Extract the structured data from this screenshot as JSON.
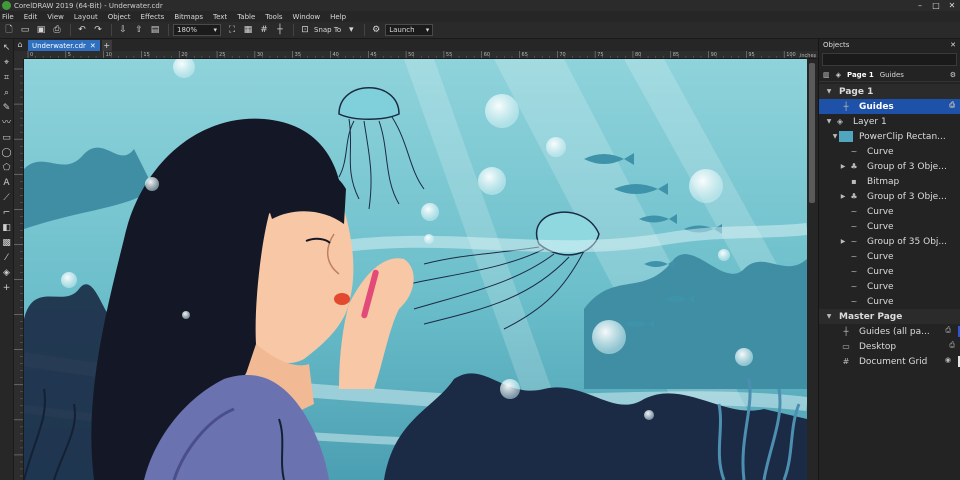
{
  "window": {
    "title": "CorelDRAW 2019 (64-Bit) - Underwater.cdr"
  },
  "menu": [
    "File",
    "Edit",
    "View",
    "Layout",
    "Object",
    "Effects",
    "Bitmaps",
    "Text",
    "Table",
    "Tools",
    "Window",
    "Help"
  ],
  "toolbar": {
    "zoom": "180%",
    "snap_to": "Snap To",
    "launch": "Launch"
  },
  "document_tab": {
    "label": "Underwater.cdr"
  },
  "ruler": {
    "ticks": [
      "0",
      "5",
      "10",
      "15",
      "20",
      "25",
      "30",
      "35",
      "40",
      "45",
      "50",
      "55",
      "60",
      "65",
      "70",
      "75",
      "80",
      "85",
      "90",
      "95",
      "100"
    ],
    "unit": "inches"
  },
  "docker": {
    "title": "Objects",
    "toolbar": {
      "page": "Page 1",
      "guides": "Guides"
    },
    "tree": [
      {
        "label": "Page 1"
      },
      {
        "label": "Guides"
      },
      {
        "label": "Layer 1"
      },
      {
        "label": "PowerClip Rectan..."
      },
      {
        "label": "Curve"
      },
      {
        "label": "Group of 3 Obje..."
      },
      {
        "label": "Bitmap"
      },
      {
        "label": "Group of 3 Obje..."
      },
      {
        "label": "Curve"
      },
      {
        "label": "Curve"
      },
      {
        "label": "Group of 35 Obj..."
      },
      {
        "label": "Curve"
      },
      {
        "label": "Curve"
      },
      {
        "label": "Curve"
      },
      {
        "label": "Curve"
      },
      {
        "label": "Master Page"
      },
      {
        "label": "Guides (all pa..."
      },
      {
        "label": "Desktop"
      },
      {
        "label": "Document Grid"
      }
    ]
  },
  "colors": {
    "accent": "#1e52a8",
    "tab": "#2e6fbf",
    "water": "#6fc0cc",
    "dark": "#1b2a45"
  }
}
